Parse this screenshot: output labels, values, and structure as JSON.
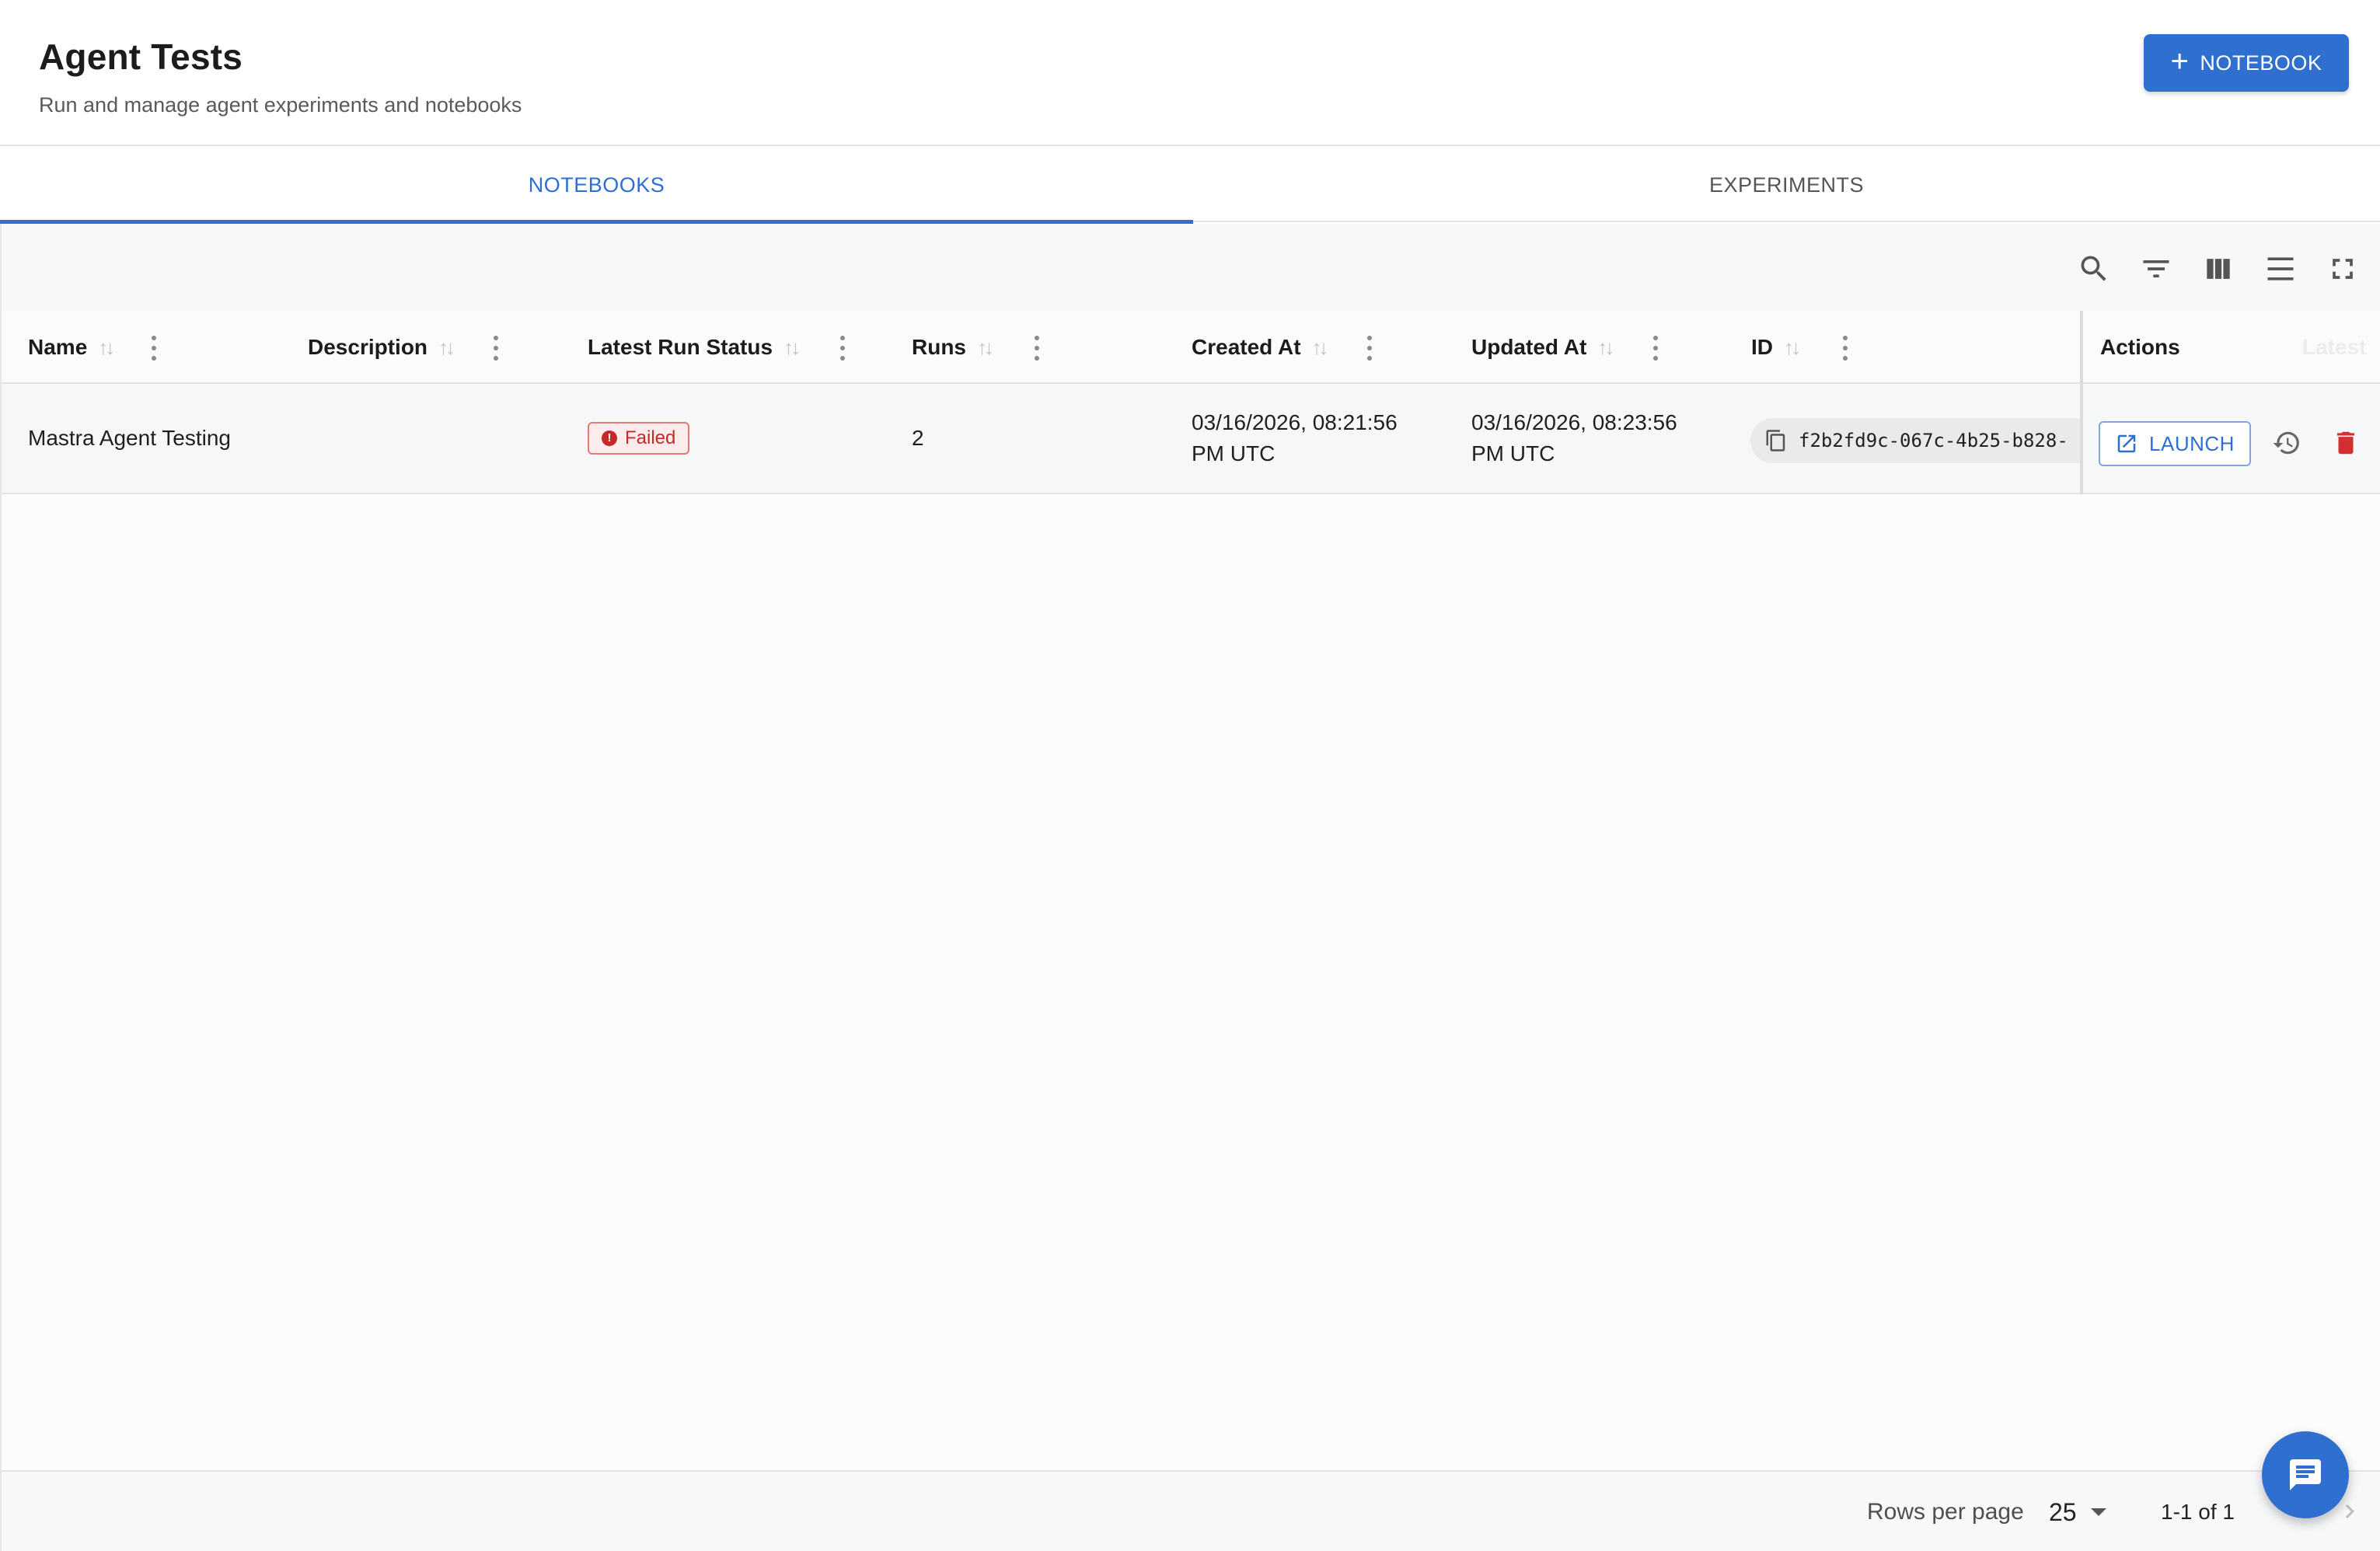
{
  "header": {
    "title": "Agent Tests",
    "subtitle": "Run and manage agent experiments and notebooks",
    "new_button_label": "NOTEBOOK",
    "new_button_icon": "plus-icon"
  },
  "tabs": [
    {
      "label": "NOTEBOOKS",
      "active": true
    },
    {
      "label": "EXPERIMENTS",
      "active": false
    }
  ],
  "toolbar": {
    "icons": [
      "search-icon",
      "filter-icon",
      "columns-icon",
      "density-icon",
      "fullscreen-icon"
    ]
  },
  "table": {
    "columns": [
      "Name",
      "Description",
      "Latest Run Status",
      "Runs",
      "Created At",
      "Updated At",
      "ID",
      "Actions"
    ],
    "faded_column": "Latest",
    "rows": [
      {
        "name": "Mastra Agent Testing",
        "description": "",
        "status": "Failed",
        "runs": "2",
        "created_at_line1": "03/16/2026, 08:21:56",
        "created_at_line2": "PM UTC",
        "updated_at_line1": "03/16/2026, 08:23:56",
        "updated_at_line2": "PM UTC",
        "id": "f2b2fd9c-067c-4b25-b828-",
        "launch_label": "LAUNCH"
      }
    ]
  },
  "footer": {
    "rows_per_page_label": "Rows per page",
    "rows_per_page_value": "25",
    "page_range": "1-1 of 1"
  },
  "colors": {
    "primary": "#2f6fd0",
    "danger": "#c62828"
  }
}
